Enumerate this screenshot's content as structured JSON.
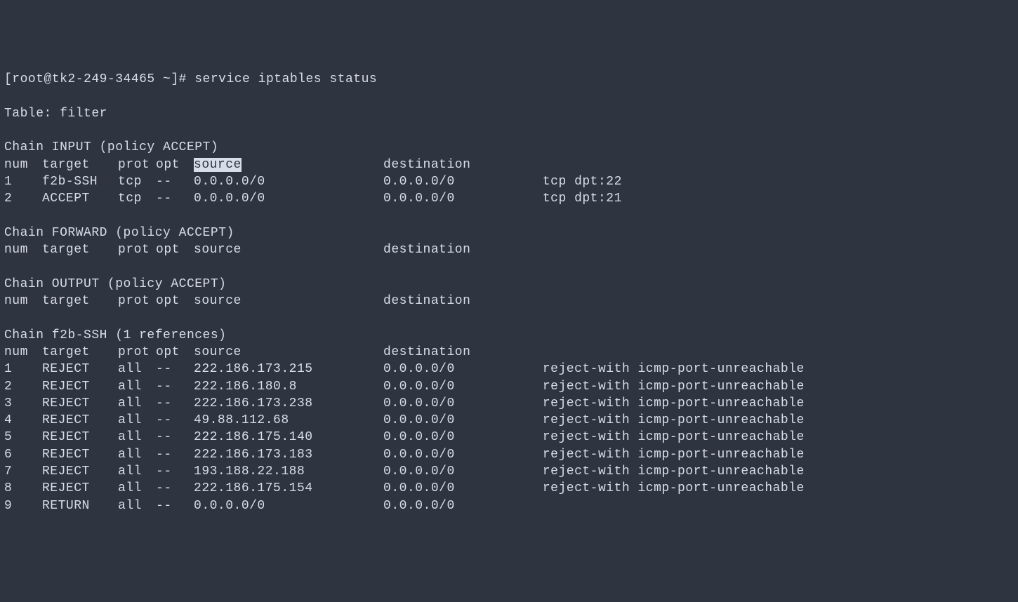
{
  "prompt_prefix": "[root@tk2-249-34465 ~]# ",
  "command": "service iptables status",
  "table_line": "Table: filter",
  "headers": {
    "num": "num",
    "target": "target",
    "prot": "prot",
    "opt": "opt",
    "source": "source",
    "destination": "destination"
  },
  "chains": [
    {
      "title": "Chain INPUT (policy ACCEPT)",
      "highlight_source_header": true,
      "rules": [
        {
          "num": "1",
          "target": "f2b-SSH",
          "prot": "tcp",
          "opt": "--",
          "source": "0.0.0.0/0",
          "destination": "0.0.0.0/0",
          "extra": "tcp dpt:22"
        },
        {
          "num": "2",
          "target": "ACCEPT",
          "prot": "tcp",
          "opt": "--",
          "source": "0.0.0.0/0",
          "destination": "0.0.0.0/0",
          "extra": "tcp dpt:21"
        }
      ]
    },
    {
      "title": "Chain FORWARD (policy ACCEPT)",
      "rules": []
    },
    {
      "title": "Chain OUTPUT (policy ACCEPT)",
      "rules": []
    },
    {
      "title": "Chain f2b-SSH (1 references)",
      "rules": [
        {
          "num": "1",
          "target": "REJECT",
          "prot": "all",
          "opt": "--",
          "source": "222.186.173.215",
          "destination": "0.0.0.0/0",
          "extra": "reject-with icmp-port-unreachable"
        },
        {
          "num": "2",
          "target": "REJECT",
          "prot": "all",
          "opt": "--",
          "source": "222.186.180.8",
          "destination": "0.0.0.0/0",
          "extra": "reject-with icmp-port-unreachable"
        },
        {
          "num": "3",
          "target": "REJECT",
          "prot": "all",
          "opt": "--",
          "source": "222.186.173.238",
          "destination": "0.0.0.0/0",
          "extra": "reject-with icmp-port-unreachable"
        },
        {
          "num": "4",
          "target": "REJECT",
          "prot": "all",
          "opt": "--",
          "source": "49.88.112.68",
          "destination": "0.0.0.0/0",
          "extra": "reject-with icmp-port-unreachable"
        },
        {
          "num": "5",
          "target": "REJECT",
          "prot": "all",
          "opt": "--",
          "source": "222.186.175.140",
          "destination": "0.0.0.0/0",
          "extra": "reject-with icmp-port-unreachable"
        },
        {
          "num": "6",
          "target": "REJECT",
          "prot": "all",
          "opt": "--",
          "source": "222.186.173.183",
          "destination": "0.0.0.0/0",
          "extra": "reject-with icmp-port-unreachable"
        },
        {
          "num": "7",
          "target": "REJECT",
          "prot": "all",
          "opt": "--",
          "source": "193.188.22.188",
          "destination": "0.0.0.0/0",
          "extra": "reject-with icmp-port-unreachable"
        },
        {
          "num": "8",
          "target": "REJECT",
          "prot": "all",
          "opt": "--",
          "source": "222.186.175.154",
          "destination": "0.0.0.0/0",
          "extra": "reject-with icmp-port-unreachable"
        },
        {
          "num": "9",
          "target": "RETURN",
          "prot": "all",
          "opt": "--",
          "source": "0.0.0.0/0",
          "destination": "0.0.0.0/0",
          "extra": ""
        }
      ]
    }
  ]
}
